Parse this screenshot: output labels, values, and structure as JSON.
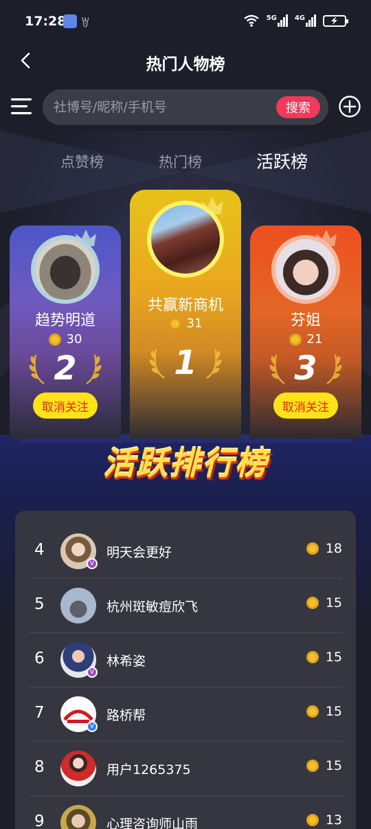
{
  "status_bar": {
    "time": "17:28",
    "network1": "5G",
    "network2": "4G"
  },
  "nav": {
    "title": "热门人物榜"
  },
  "search": {
    "placeholder": "社博号/昵称/手机号",
    "value": "",
    "button_label": "搜索"
  },
  "tabs": [
    {
      "label": "点赞榜",
      "active": false
    },
    {
      "label": "热门榜",
      "active": false
    },
    {
      "label": "活跃榜",
      "active": true
    }
  ],
  "podium": {
    "first": {
      "rank": "1",
      "name": "共赢新商机",
      "score": "31"
    },
    "second": {
      "rank": "2",
      "name": "趋势明道",
      "score": "30",
      "button_label": "取消关注"
    },
    "third": {
      "rank": "3",
      "name": "芬姐",
      "score": "21",
      "button_label": "取消关注"
    }
  },
  "banner": {
    "title": "活跃排行榜"
  },
  "list": [
    {
      "rank": "4",
      "name": "明天会更好",
      "score": "18",
      "badge": "V"
    },
    {
      "rank": "5",
      "name": "杭州斑敏痘欣飞",
      "score": "15",
      "badge": ""
    },
    {
      "rank": "6",
      "name": "林希姿",
      "score": "15",
      "badge": "V"
    },
    {
      "rank": "7",
      "name": "路桥帮",
      "score": "15",
      "badge": "V"
    },
    {
      "rank": "8",
      "name": "用户1265375",
      "score": "15",
      "badge": ""
    },
    {
      "rank": "9",
      "name": "心理咨询师山雨",
      "score": "13",
      "badge": ""
    }
  ],
  "colors": {
    "background": "#1c1e2a",
    "accent_red": "#f2395a",
    "gold": "#e7c21a",
    "purple": "#4d56c8",
    "orange": "#ee4f1f",
    "button_yellow": "#ffe21a",
    "list_card": "#353640"
  },
  "icons": [
    "back-icon",
    "menu-icon",
    "add-icon",
    "crown-icon",
    "coin-icon",
    "laurel-icon",
    "verified-badge-icon"
  ]
}
